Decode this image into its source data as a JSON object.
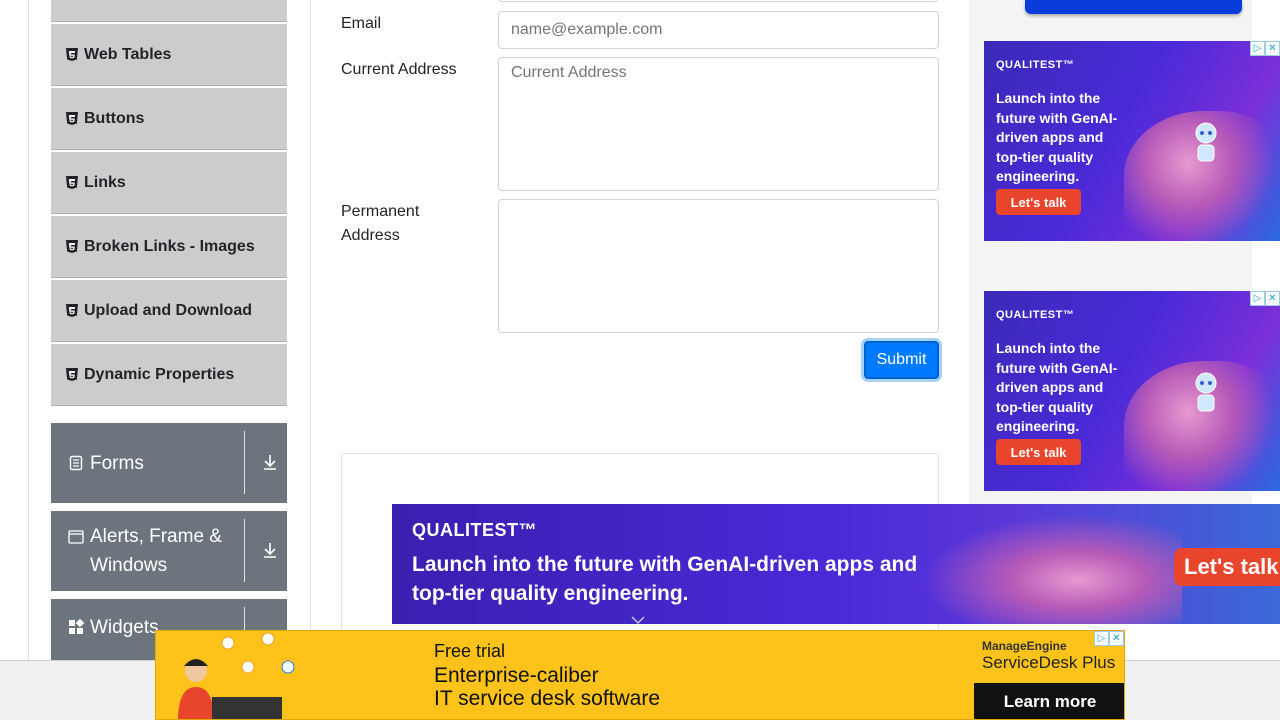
{
  "sidebar": {
    "menu_items": [
      {
        "label": "Web Tables"
      },
      {
        "label": "Buttons"
      },
      {
        "label": "Links"
      },
      {
        "label": "Broken Links - Images"
      },
      {
        "label": "Upload and Download"
      },
      {
        "label": "Dynamic Properties"
      }
    ],
    "groups": [
      {
        "label": "Forms"
      },
      {
        "label": "Alerts, Frame & Windows"
      },
      {
        "label": "Widgets"
      }
    ]
  },
  "form": {
    "email_label": "Email",
    "email_placeholder": "name@example.com",
    "current_address_label": "Current Address",
    "current_address_placeholder": "Current Address",
    "permanent_address_label": "Permanent Address",
    "submit_label": "Submit"
  },
  "ads": {
    "side_brand": "QUALITEST™",
    "side_copy": "Launch into the future with GenAI-driven apps and top-tier quality engineering.",
    "side_cta": "Let's talk",
    "banner_brand": "QUALITEST™",
    "banner_copy": "Launch into the future with GenAI-driven apps and top-tier quality engineering.",
    "banner_cta": "Let's talk",
    "yellow_line1": "Free trial",
    "yellow_line2": "Enterprise-caliber",
    "yellow_line3": "IT service desk software",
    "yellow_logo_top": "ManageEngine",
    "yellow_logo_name": "ServiceDesk Plus",
    "yellow_cta": "Learn more"
  },
  "colors": {
    "primary": "#007bff",
    "sidebar_item_bg": "#cccccc",
    "group_bg": "#6c757d",
    "ad_cta": "#e8452c",
    "yellow_ad": "#fdc31b"
  }
}
